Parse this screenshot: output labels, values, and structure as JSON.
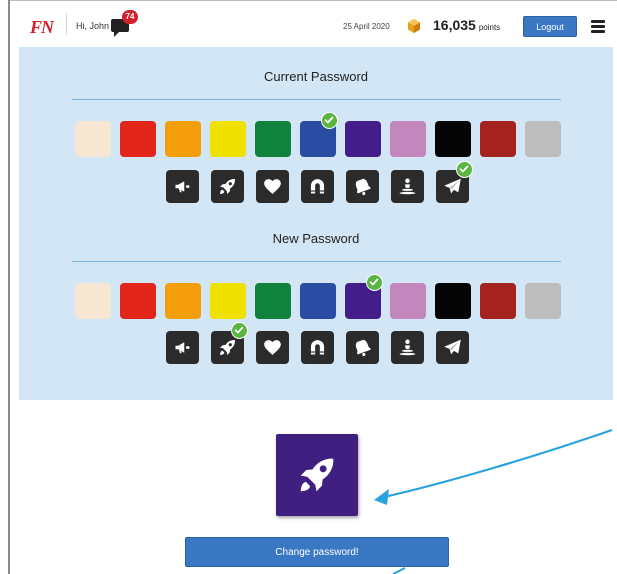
{
  "header": {
    "logo": "FN",
    "greeting": "Hi, John",
    "messages_count": "74",
    "date": "25 April 2020",
    "points_value": "16,035",
    "points_unit": "points",
    "logout_label": "Logout"
  },
  "colors": {
    "swatches": [
      "#f7e6d2",
      "#e1251b",
      "#f59e0b",
      "#f0e000",
      "#11823b",
      "#2a4da3",
      "#431d8a",
      "#c387be",
      "#050505",
      "#a4231e",
      "#bdbdbd"
    ],
    "panel_bg": "#d3e6f5",
    "accent": "#3a78c3",
    "check": "#5bb543",
    "preview_bg": "#3f1f7f"
  },
  "icons": [
    "megaphone-icon",
    "rocket-icon",
    "heart-icon",
    "magnet-icon",
    "bell-icon",
    "person-icon",
    "paper-plane-icon"
  ],
  "current_password": {
    "title": "Current Password",
    "selected_color": "blue",
    "selected_icon": "paper-plane"
  },
  "new_password": {
    "title": "New Password",
    "selected_color": "purple",
    "selected_icon": "rocket"
  },
  "preview": {
    "icon": "rocket-icon"
  },
  "change_button_label": "Change password!"
}
